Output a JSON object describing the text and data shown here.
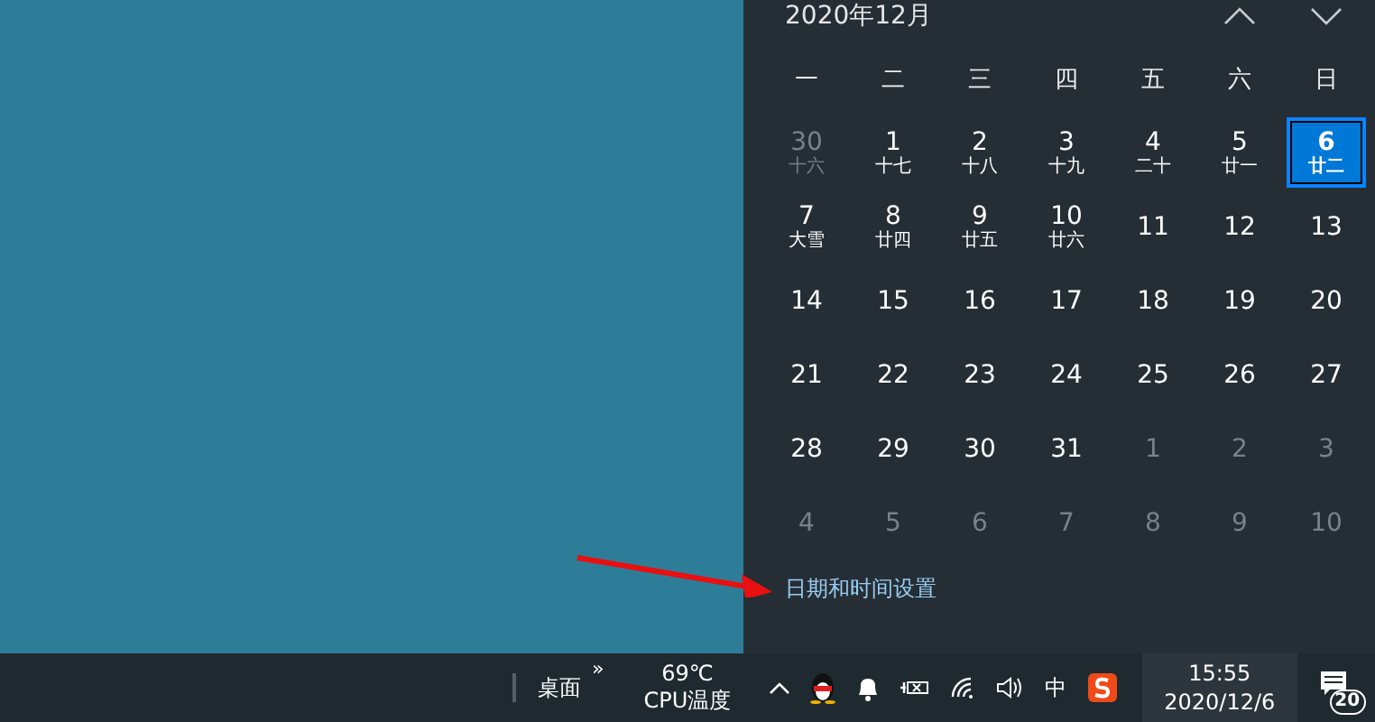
{
  "calendar": {
    "month_title": "2020年12月",
    "weekdays": [
      "一",
      "二",
      "三",
      "四",
      "五",
      "六",
      "日"
    ],
    "days": [
      {
        "day": "30",
        "lunar": "十六",
        "kind": "other",
        "selected": false
      },
      {
        "day": "1",
        "lunar": "十七",
        "kind": "current",
        "selected": false
      },
      {
        "day": "2",
        "lunar": "十八",
        "kind": "current",
        "selected": false
      },
      {
        "day": "3",
        "lunar": "十九",
        "kind": "current",
        "selected": false
      },
      {
        "day": "4",
        "lunar": "二十",
        "kind": "current",
        "selected": false
      },
      {
        "day": "5",
        "lunar": "廿一",
        "kind": "current",
        "selected": false
      },
      {
        "day": "6",
        "lunar": "廿二",
        "kind": "current",
        "selected": true
      },
      {
        "day": "7",
        "lunar": "大雪",
        "kind": "current",
        "selected": false
      },
      {
        "day": "8",
        "lunar": "廿四",
        "kind": "current",
        "selected": false
      },
      {
        "day": "9",
        "lunar": "廿五",
        "kind": "current",
        "selected": false
      },
      {
        "day": "10",
        "lunar": "廿六",
        "kind": "current",
        "selected": false
      },
      {
        "day": "11",
        "kind": "current",
        "selected": false
      },
      {
        "day": "12",
        "kind": "current",
        "selected": false
      },
      {
        "day": "13",
        "kind": "current",
        "selected": false
      },
      {
        "day": "14",
        "kind": "current",
        "selected": false
      },
      {
        "day": "15",
        "kind": "current",
        "selected": false
      },
      {
        "day": "16",
        "kind": "current",
        "selected": false
      },
      {
        "day": "17",
        "kind": "current",
        "selected": false
      },
      {
        "day": "18",
        "kind": "current",
        "selected": false
      },
      {
        "day": "19",
        "kind": "current",
        "selected": false
      },
      {
        "day": "20",
        "kind": "current",
        "selected": false
      },
      {
        "day": "21",
        "kind": "current",
        "selected": false
      },
      {
        "day": "22",
        "kind": "current",
        "selected": false
      },
      {
        "day": "23",
        "kind": "current",
        "selected": false
      },
      {
        "day": "24",
        "kind": "current",
        "selected": false
      },
      {
        "day": "25",
        "kind": "current",
        "selected": false
      },
      {
        "day": "26",
        "kind": "current",
        "selected": false
      },
      {
        "day": "27",
        "kind": "current",
        "selected": false
      },
      {
        "day": "28",
        "kind": "current",
        "selected": false
      },
      {
        "day": "29",
        "kind": "current",
        "selected": false
      },
      {
        "day": "30",
        "kind": "current",
        "selected": false
      },
      {
        "day": "31",
        "kind": "current",
        "selected": false
      },
      {
        "day": "1",
        "kind": "other",
        "selected": false
      },
      {
        "day": "2",
        "kind": "other",
        "selected": false
      },
      {
        "day": "3",
        "kind": "other",
        "selected": false
      },
      {
        "day": "4",
        "kind": "other",
        "selected": false
      },
      {
        "day": "5",
        "kind": "other",
        "selected": false
      },
      {
        "day": "6",
        "kind": "other",
        "selected": false
      },
      {
        "day": "7",
        "kind": "other",
        "selected": false
      },
      {
        "day": "8",
        "kind": "other",
        "selected": false
      },
      {
        "day": "9",
        "kind": "other",
        "selected": false
      },
      {
        "day": "10",
        "kind": "other",
        "selected": false
      }
    ],
    "settings_link": "日期和时间设置"
  },
  "taskbar": {
    "desktop_label": "桌面",
    "more_label": "»",
    "cpu_temp": "69℃",
    "cpu_label": "CPU温度",
    "ime": "中",
    "time": "15:55",
    "date": "2020/12/6",
    "notification_count": "20"
  }
}
